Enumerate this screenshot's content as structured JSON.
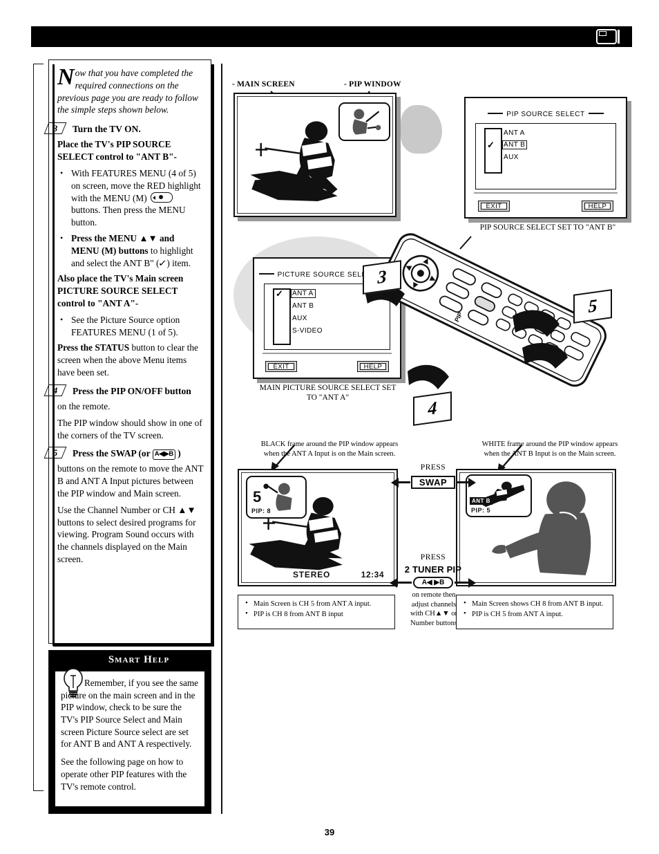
{
  "page": {
    "number": "39",
    "header_icon": "tv-pip-icon"
  },
  "left_column": {
    "intro": {
      "dropcap": "N",
      "text": "ow that you have completed the required connections on the previous page you are ready to follow the simple steps shown below."
    },
    "steps": [
      {
        "number": "3",
        "title": "Turn the TV ON.",
        "blocks": [
          {
            "type": "bold_head",
            "text": "Place the TV's PIP SOURCE SELECT control to \"ANT B\"-"
          },
          {
            "type": "bullet",
            "text": "With FEATURES MENU (4 of 5) on screen, move the RED highlight with the MENU (M)",
            "tail": "buttons. Then press the MENU button.",
            "glyph": "menu-pad-icon"
          },
          {
            "type": "bullet_bold",
            "bold": "Press the MENU ▲▼ and MENU (M) buttons",
            "rest": "to highlight and select the ANT B\" (",
            "glyph": "checkmark-icon",
            "end": ") item."
          },
          {
            "type": "bold_head",
            "text": "Also place the TV's Main screen PICTURE SOURCE SELECT control to \"ANT A\"-"
          },
          {
            "type": "bullet",
            "text": "See the Picture Source option FEATURES MENU (1 of 5)."
          },
          {
            "type": "mixed",
            "bold": "Press the STATUS",
            "rest": "button to clear the screen when the above Menu items have been set."
          }
        ]
      },
      {
        "number": "4",
        "title": "Press the PIP ON/OFF button",
        "blocks": [
          {
            "type": "plain",
            "text": "on the remote."
          },
          {
            "type": "plain",
            "text": "The PIP window should show in one of the corners of the TV screen."
          }
        ]
      },
      {
        "number": "5",
        "title": "Press the SWAP (or",
        "title_glyph": "swap-ab-icon",
        "title_end": ")",
        "blocks": [
          {
            "type": "plain",
            "text": "buttons on the remote to move the ANT B and ANT A Input pictures between the PIP window and Main screen."
          },
          {
            "type": "plain",
            "text": "Use the Channel Number or CH ▲▼ buttons to select desired programs for viewing. Program Sound occurs with the channels displayed on the Main screen."
          }
        ]
      }
    ],
    "smart_help": {
      "title": "Smart Help",
      "icon": "lightbulb-icon",
      "paragraphs": [
        "Remember, if you see the same picture on the main screen and in the PIP window, check to be sure the TV's PIP Source Select and Main screen Picture Source select are set for ANT B and ANT A respectively.",
        "See the following page on how to operate other PIP features with the TV's remote control."
      ]
    }
  },
  "illustrations": {
    "top_tv": {
      "label_main": "- MAIN SCREEN",
      "label_pip": "- PIP WINDOW"
    },
    "pip_source_menu": {
      "title": "PIP SOURCE SELECT",
      "items": [
        "ANT A",
        "ANT B",
        "AUX"
      ],
      "selected": "ANT B",
      "checked_index": 1,
      "buttons": [
        "EXIT",
        "HELP"
      ],
      "caption": "PIP SOURCE SELECT SET TO \"ANT B\""
    },
    "picture_source_menu": {
      "title": "PICTURE SOURCE SELECT",
      "items": [
        "ANT A",
        "ANT B",
        "AUX",
        "S-VIDEO"
      ],
      "selected": "ANT A",
      "checked_index": 0,
      "buttons": [
        "EXIT",
        "HELP"
      ],
      "caption_line1": "MAIN PICTURE SOURCE SELECT SET",
      "caption_line2": "TO \"ANT A\""
    },
    "remote": {
      "markers": [
        "3",
        "4",
        "5"
      ]
    },
    "bottom_left": {
      "caption_line1": "BLACK frame around the PIP window appears",
      "caption_line2": "when the ANT A Input is on the Main screen.",
      "screen_channel": "5",
      "pip_label": "PIP: 8",
      "status_stereo": "STEREO",
      "status_time": "12:34",
      "notes": [
        "Main Screen is CH 5 from ANT A input.",
        "PIP is CH 8 from ANT B input"
      ]
    },
    "bottom_right": {
      "caption_line1": "WHITE frame around the PIP window appears",
      "caption_line2": "when the ANT B Input is on the Main screen.",
      "pip_source_tag": "ANT B",
      "pip_label": "PIP: 5",
      "notes": [
        "Main Screen shows CH 8 from ANT B input.",
        "PIP is CH 5 from ANT A input."
      ]
    },
    "center_controls": {
      "press_1": "PRESS",
      "swap_label": "SWAP",
      "press_2": "PRESS",
      "tuner_label": "2 TUNER PIP",
      "ab_button": "A◀ ▶B",
      "footnote_line1": "on remote then",
      "footnote_line2": "adjust channels",
      "footnote_line3": "with CH▲▼ or",
      "footnote_line4": "Number buttons"
    }
  }
}
